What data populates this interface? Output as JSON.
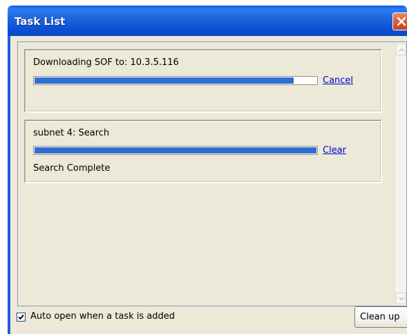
{
  "window": {
    "title": "Task List",
    "colors": {
      "titlebar": "#1c63dc",
      "close_button": "#d65a2f",
      "progress_fill": "#2f6fd0",
      "link": "#0000cc"
    }
  },
  "tasks": [
    {
      "name": "Downloading SOF to: 10.3.5.116",
      "progress": 0.92,
      "action_label": "Cancel",
      "status": ""
    },
    {
      "name": "subnet 4: Search",
      "progress": 1.0,
      "action_label": "Clear",
      "status": "Search Complete"
    }
  ],
  "footer": {
    "auto_open_checked": true,
    "auto_open_label": "Auto open when a task is added",
    "cleanup_label": "Clean up"
  },
  "icons": [
    "close-icon",
    "scroll-up-icon",
    "scroll-down-icon",
    "checkmark-icon"
  ]
}
